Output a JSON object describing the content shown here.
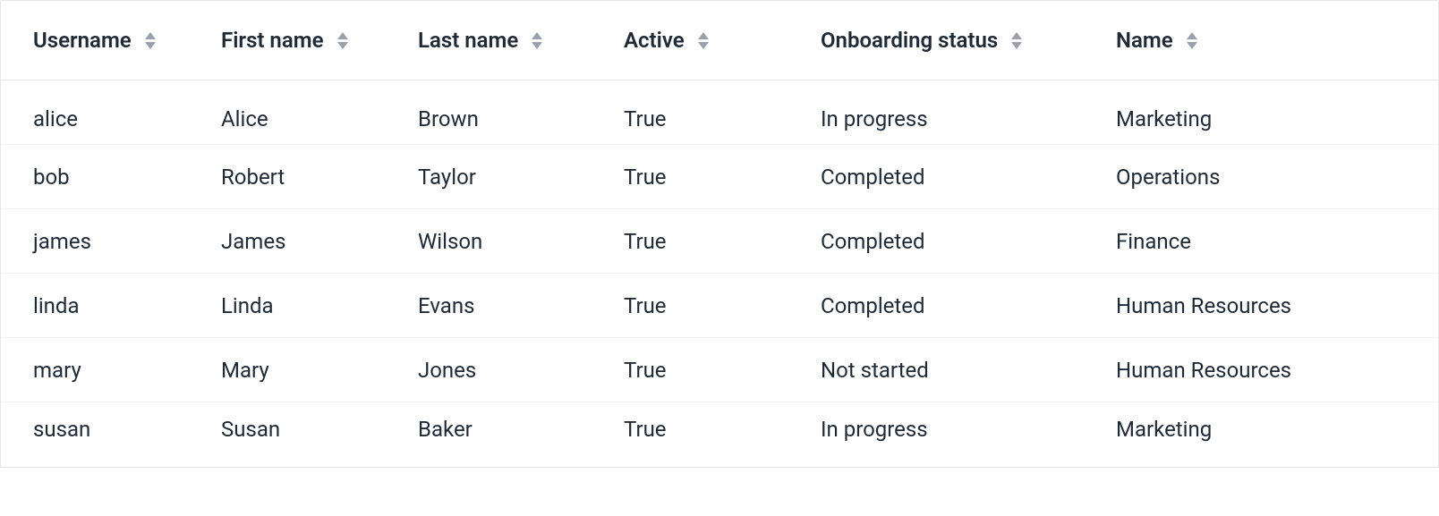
{
  "table": {
    "columns": [
      {
        "key": "username",
        "label": "Username"
      },
      {
        "key": "first_name",
        "label": "First name"
      },
      {
        "key": "last_name",
        "label": "Last name"
      },
      {
        "key": "active",
        "label": "Active"
      },
      {
        "key": "onboarding",
        "label": "Onboarding status"
      },
      {
        "key": "name",
        "label": "Name"
      }
    ],
    "rows": [
      {
        "username": "alice",
        "first_name": "Alice",
        "last_name": "Brown",
        "active": "True",
        "onboarding": "In progress",
        "name": "Marketing"
      },
      {
        "username": "bob",
        "first_name": "Robert",
        "last_name": "Taylor",
        "active": "True",
        "onboarding": "Completed",
        "name": "Operations"
      },
      {
        "username": "james",
        "first_name": "James",
        "last_name": "Wilson",
        "active": "True",
        "onboarding": "Completed",
        "name": "Finance"
      },
      {
        "username": "linda",
        "first_name": "Linda",
        "last_name": "Evans",
        "active": "True",
        "onboarding": "Completed",
        "name": "Human Resources"
      },
      {
        "username": "mary",
        "first_name": "Mary",
        "last_name": "Jones",
        "active": "True",
        "onboarding": "Not started",
        "name": "Human Resources"
      },
      {
        "username": "susan",
        "first_name": "Susan",
        "last_name": "Baker",
        "active": "True",
        "onboarding": "In progress",
        "name": "Marketing"
      }
    ]
  }
}
